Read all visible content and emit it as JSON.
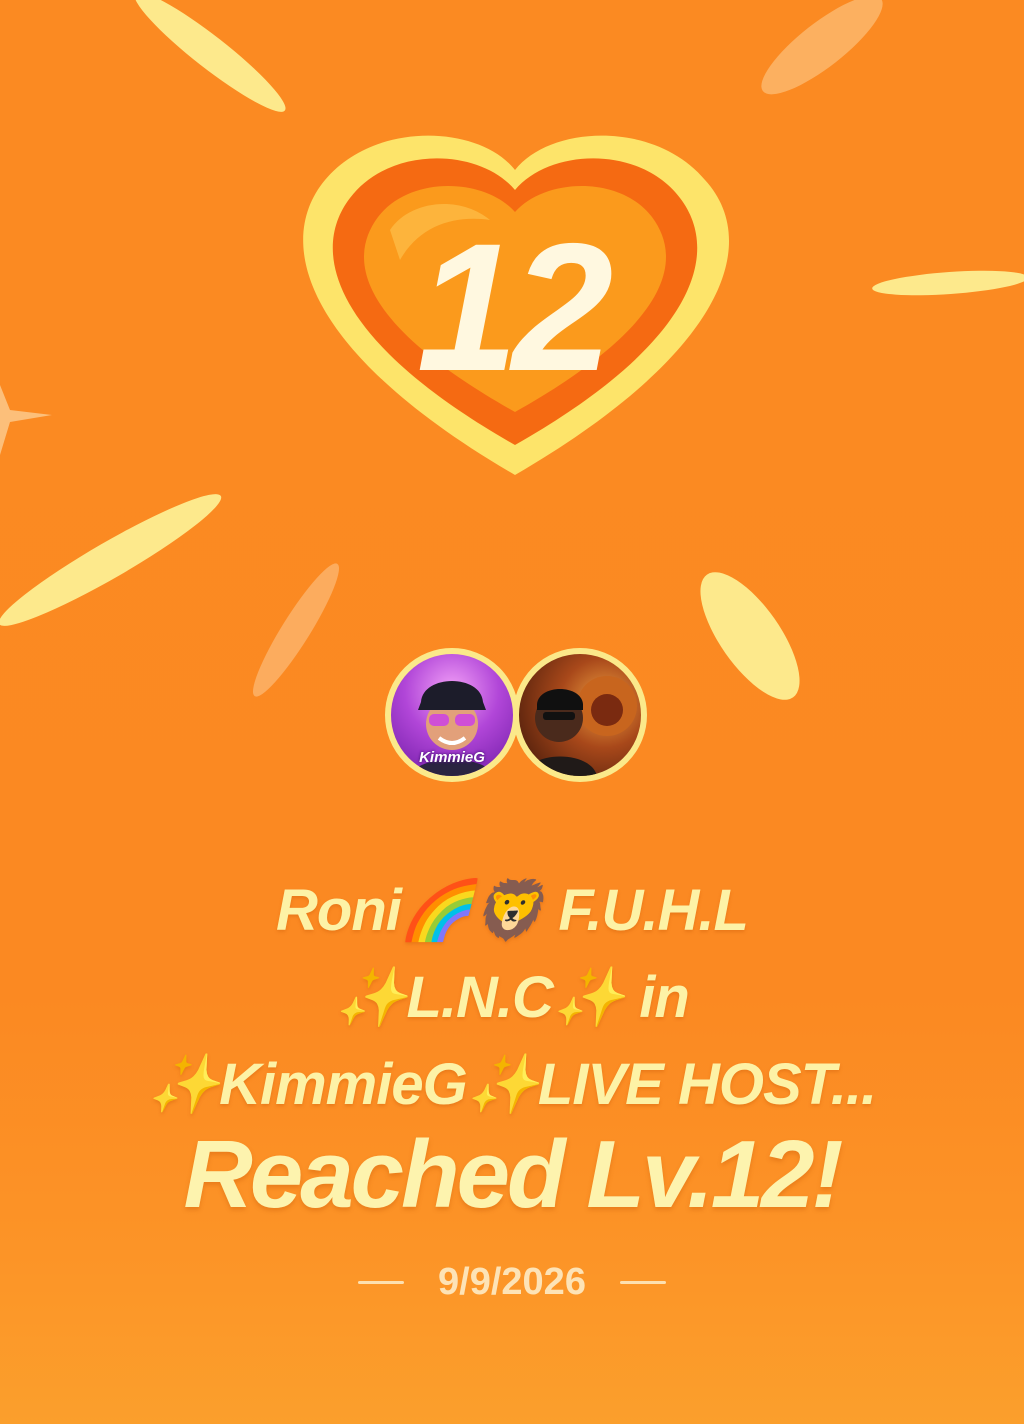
{
  "badge": {
    "level_number": "12"
  },
  "participants": [
    {
      "name": "KimmieG",
      "avatar_tag": "KimmieG"
    },
    {
      "name": "Roni"
    }
  ],
  "caption": {
    "line1": "Roni🌈🦁 F.U.H.L",
    "line2": "✨L.N.C✨ in",
    "line3": "✨KimmieG✨LIVE HOST...",
    "headline": "Reached Lv.12!"
  },
  "date": "9/9/2026",
  "colors": {
    "background": "#fb8a22",
    "text": "#fdf2a6",
    "heart_outer": "#fde46a",
    "heart_inner": "#f15a0e",
    "heart_core": "#fb9a1c"
  }
}
